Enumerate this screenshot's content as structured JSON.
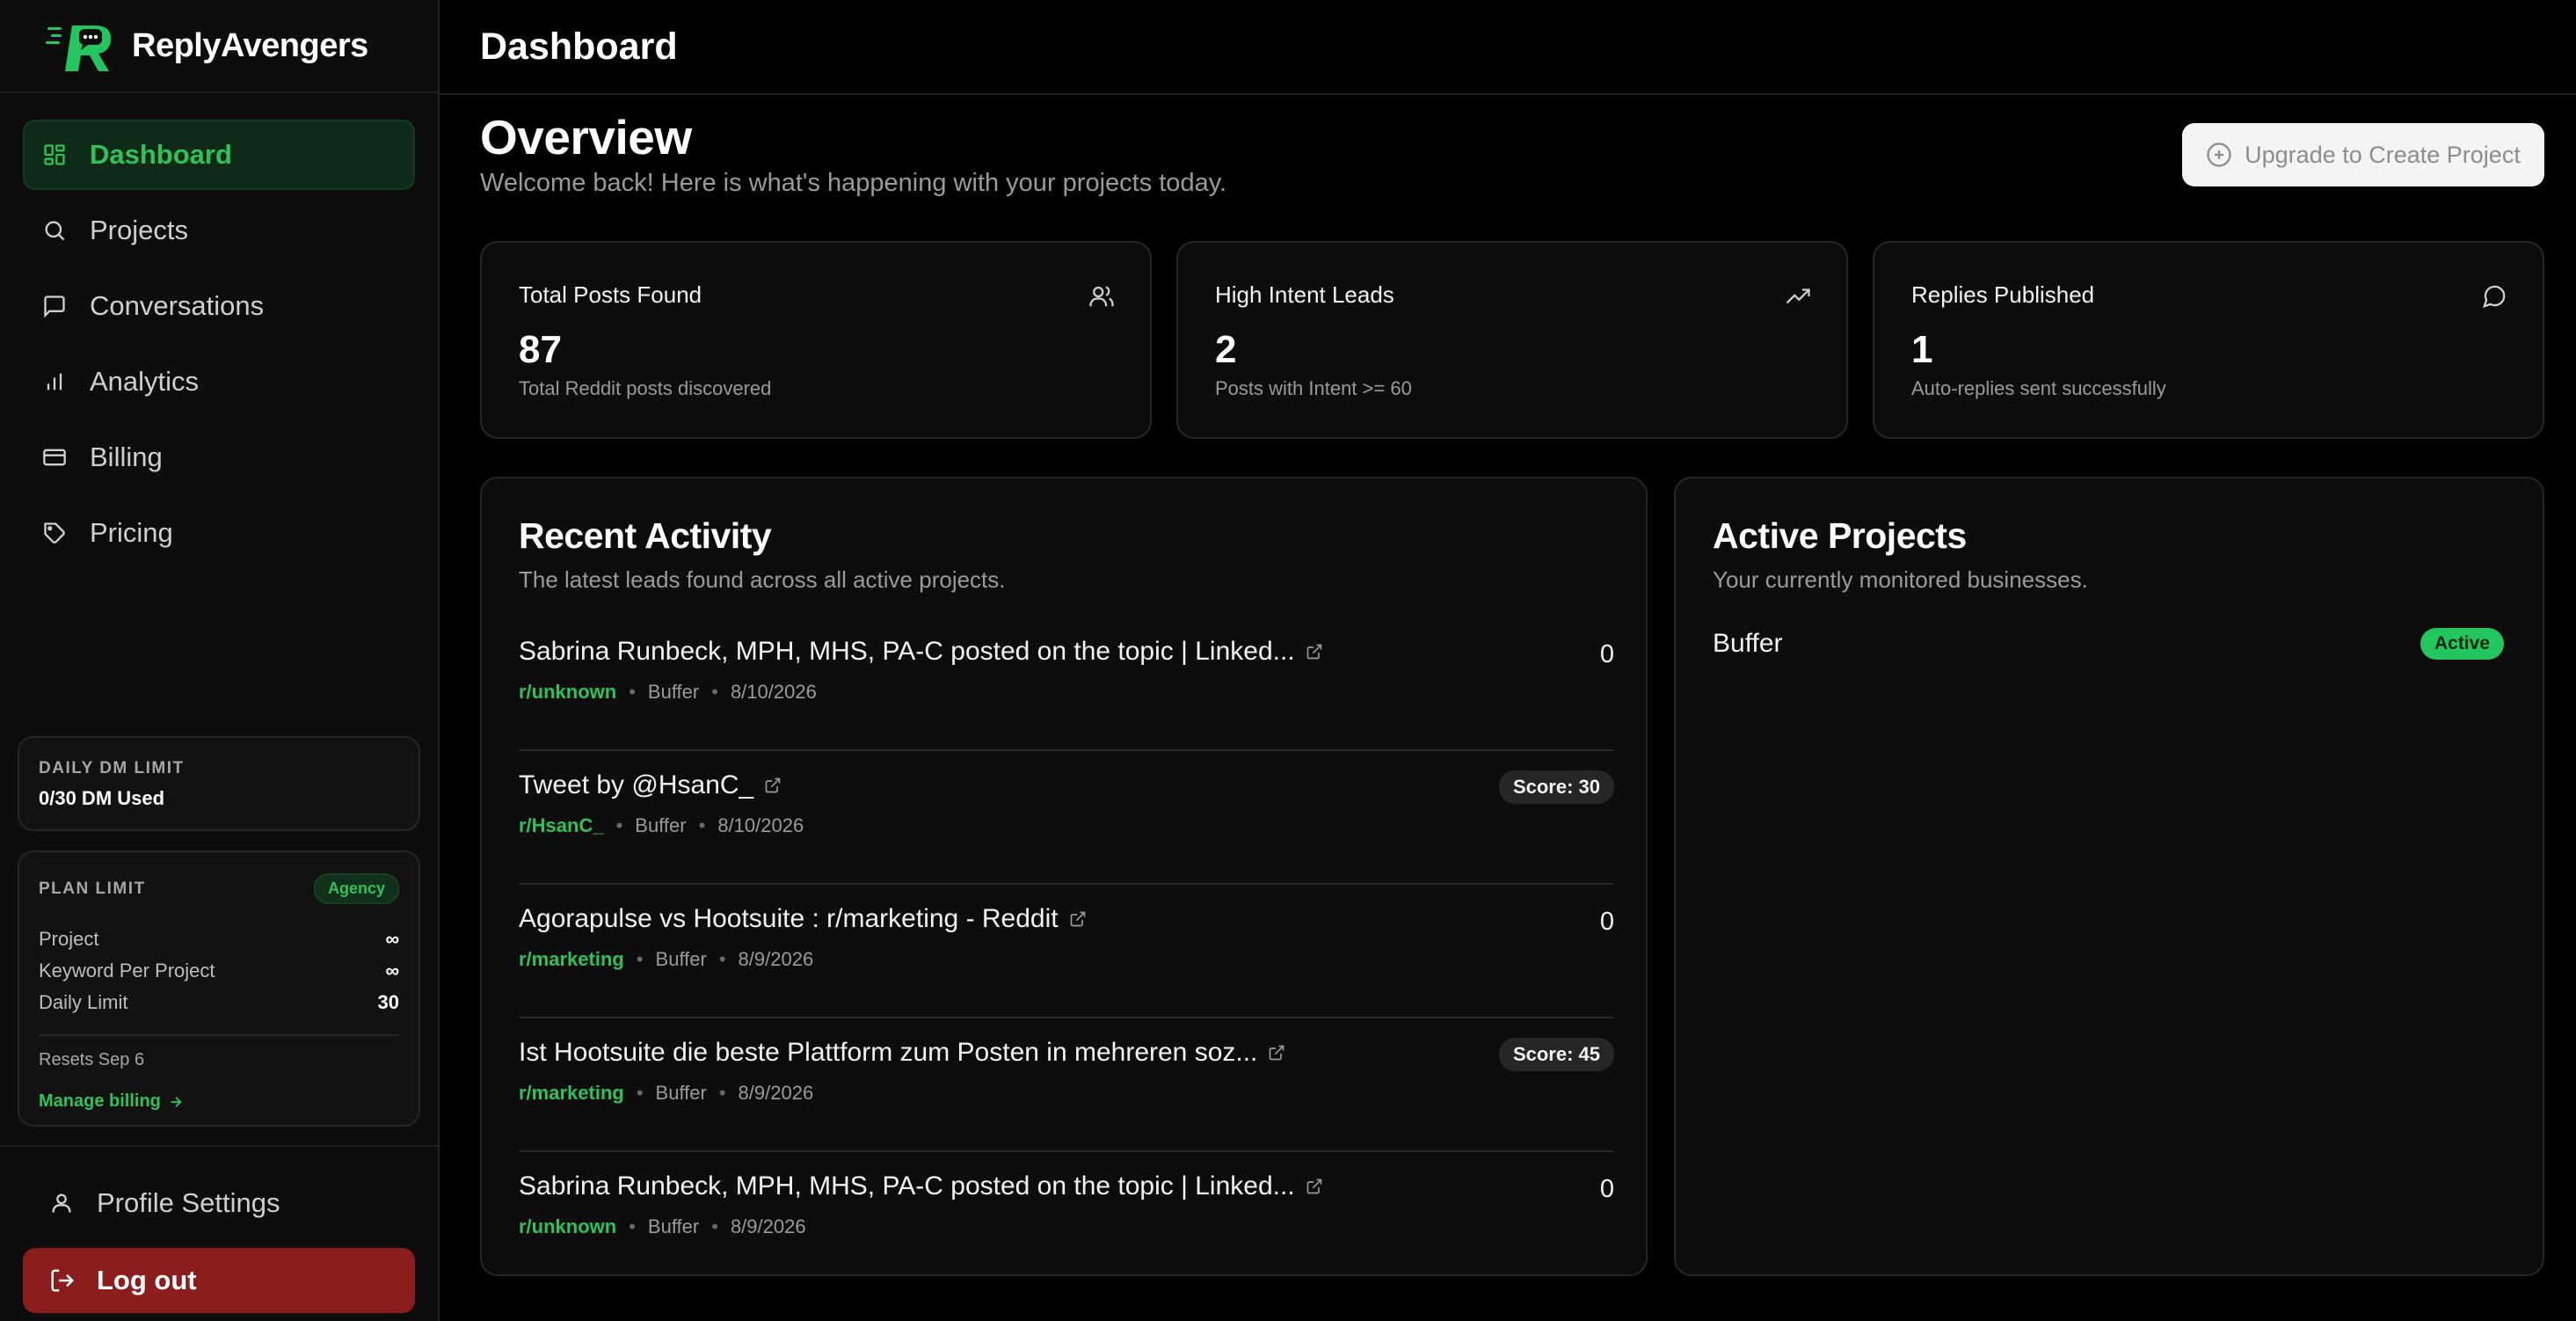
{
  "brand": {
    "name": "ReplyAvengers"
  },
  "colors": {
    "accent": "#2fc25b",
    "danger": "#8b1d1d",
    "background": "#000000"
  },
  "sidebar": {
    "items": [
      {
        "label": "Dashboard",
        "icon": "dashboard-icon",
        "active": true
      },
      {
        "label": "Projects",
        "icon": "search-icon"
      },
      {
        "label": "Conversations",
        "icon": "chat-icon"
      },
      {
        "label": "Analytics",
        "icon": "bar-chart-icon"
      },
      {
        "label": "Billing",
        "icon": "credit-card-icon"
      },
      {
        "label": "Pricing",
        "icon": "tag-icon"
      }
    ],
    "dm_limit": {
      "label": "DAILY DM LIMIT",
      "value": "0/30 DM Used"
    },
    "plan_limit": {
      "label": "PLAN LIMIT",
      "badge": "Agency",
      "rows": [
        {
          "label": "Project",
          "value": "∞"
        },
        {
          "label": "Keyword Per Project",
          "value": "∞"
        },
        {
          "label": "Daily Limit",
          "value": "30"
        }
      ],
      "resets": "Resets Sep 6",
      "manage_billing": "Manage billing"
    },
    "profile_settings": "Profile Settings",
    "logout": "Log out"
  },
  "header": {
    "title": "Dashboard"
  },
  "overview": {
    "title": "Overview",
    "subtitle": "Welcome back! Here is what's happening with your projects today.",
    "upgrade_button": "Upgrade to Create Project"
  },
  "stats": [
    {
      "label": "Total Posts Found",
      "value": "87",
      "desc": "Total Reddit posts discovered",
      "icon": "users-icon"
    },
    {
      "label": "High Intent Leads",
      "value": "2",
      "desc": "Posts with Intent >= 60",
      "icon": "trending-up-icon"
    },
    {
      "label": "Replies Published",
      "value": "1",
      "desc": "Auto-replies sent successfully",
      "icon": "message-circle-icon"
    }
  ],
  "recent_activity": {
    "title": "Recent Activity",
    "subtitle": "The latest leads found across all active projects.",
    "items": [
      {
        "title": "Sabrina Runbeck, MPH, MHS, PA-C posted on the topic | Linked...",
        "subreddit": "r/unknown",
        "project": "Buffer",
        "date": "8/10/2026",
        "score": "0",
        "badge": false
      },
      {
        "title": "Tweet by @HsanC_",
        "subreddit": "r/HsanC_",
        "project": "Buffer",
        "date": "8/10/2026",
        "score": "Score: 30",
        "badge": true
      },
      {
        "title": "Agorapulse vs Hootsuite : r/marketing - Reddit",
        "subreddit": "r/marketing",
        "project": "Buffer",
        "date": "8/9/2026",
        "score": "0",
        "badge": false
      },
      {
        "title": "Ist Hootsuite die beste Plattform zum Posten in mehreren soz...",
        "subreddit": "r/marketing",
        "project": "Buffer",
        "date": "8/9/2026",
        "score": "Score: 45",
        "badge": true
      },
      {
        "title": "Sabrina Runbeck, MPH, MHS, PA-C posted on the topic | Linked...",
        "subreddit": "r/unknown",
        "project": "Buffer",
        "date": "8/9/2026",
        "score": "0",
        "badge": false
      }
    ]
  },
  "active_projects": {
    "title": "Active Projects",
    "subtitle": "Your currently monitored businesses.",
    "items": [
      {
        "name": "Buffer",
        "status": "Active"
      }
    ]
  }
}
